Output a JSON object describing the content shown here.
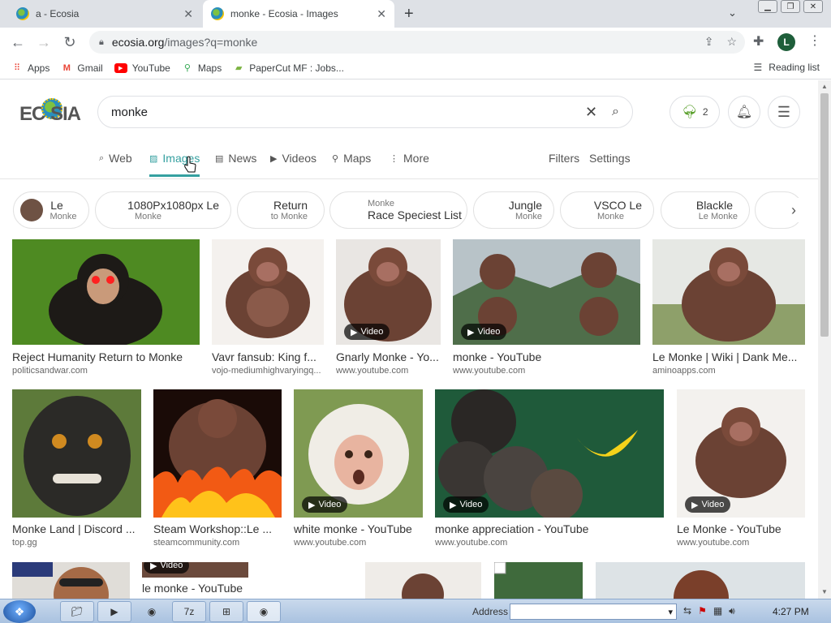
{
  "browser": {
    "tabs": [
      {
        "title": "a - Ecosia",
        "active": false
      },
      {
        "title": "monke - Ecosia - Images",
        "active": true
      }
    ],
    "url_host": "ecosia.org",
    "url_path": "/images?q=monke",
    "profile_initial": "L",
    "bookmarks": [
      {
        "label": "Apps",
        "icon": "apps-grid-icon"
      },
      {
        "label": "Gmail",
        "icon": "gmail-icon"
      },
      {
        "label": "YouTube",
        "icon": "youtube-icon"
      },
      {
        "label": "Maps",
        "icon": "maps-pin-icon"
      },
      {
        "label": "PaperCut MF : Jobs...",
        "icon": "papercut-icon"
      }
    ],
    "reading_list": "Reading list"
  },
  "ecosia": {
    "logo_left": "EC",
    "logo_right": "SIA",
    "query": "monke",
    "tree_count": "2",
    "nav": [
      {
        "label": "Web",
        "icon": "⌕"
      },
      {
        "label": "Images",
        "icon": "▨"
      },
      {
        "label": "News",
        "icon": "▤"
      },
      {
        "label": "Videos",
        "icon": "▶"
      },
      {
        "label": "Maps",
        "icon": "⚲"
      },
      {
        "label": "More",
        "icon": "⋮"
      }
    ],
    "filters": "Filters",
    "settings": "Settings",
    "chips": [
      {
        "main": "Le",
        "sub": "Monke",
        "sup": ""
      },
      {
        "main": "1080Px1080px Le",
        "sub": "Monke",
        "sup": ""
      },
      {
        "main": "Return",
        "sub": "to Monke",
        "sup": ""
      },
      {
        "main": "Race Speciest List",
        "sub": "",
        "sup": "Monke"
      },
      {
        "main": "Jungle",
        "sub": "Monke",
        "sup": ""
      },
      {
        "main": "VSCO Le",
        "sub": "Monke",
        "sup": ""
      },
      {
        "main": "Blackle",
        "sub": "Le Monke",
        "sup": ""
      }
    ],
    "video_badge": "Video",
    "results": [
      {
        "caption": "Reject Humanity Return to Monke",
        "domain": "politicsandwar.com",
        "color": "#3d6b1e"
      },
      {
        "caption": "Vavr fansub: King f...",
        "domain": "vojo-mediumhighvaryingq...",
        "color": "#f4f1ee"
      },
      {
        "caption": "Gnarly Monke - Yo...",
        "domain": "www.youtube.com",
        "color": "#e9e6e3"
      },
      {
        "caption": "monke - YouTube",
        "domain": "www.youtube.com",
        "color": "#5f7a56"
      },
      {
        "caption": "Le Monke | Wiki | Dank Me...",
        "domain": "aminoapps.com",
        "color": "#c9cfc0"
      },
      {
        "caption": "Monke Land | Discord ...",
        "domain": "top.gg",
        "color": "#4a4a44"
      },
      {
        "caption": "Steam Workshop::Le ...",
        "domain": "steamcommunity.com",
        "color": "#2a1510"
      },
      {
        "caption": "white monke - YouTube",
        "domain": "www.youtube.com",
        "color": "#8fa56a"
      },
      {
        "caption": "monke appreciation - YouTube",
        "domain": "www.youtube.com",
        "color": "#1f5a3a"
      },
      {
        "caption": "Le Monke - YouTube",
        "domain": "www.youtube.com",
        "color": "#f3f1ee"
      },
      {
        "caption": "le monke - YouTube",
        "domain": "",
        "color": "#6b4a3c"
      }
    ]
  },
  "taskbar": {
    "address_label": "Address",
    "clock": "4:27 PM"
  }
}
